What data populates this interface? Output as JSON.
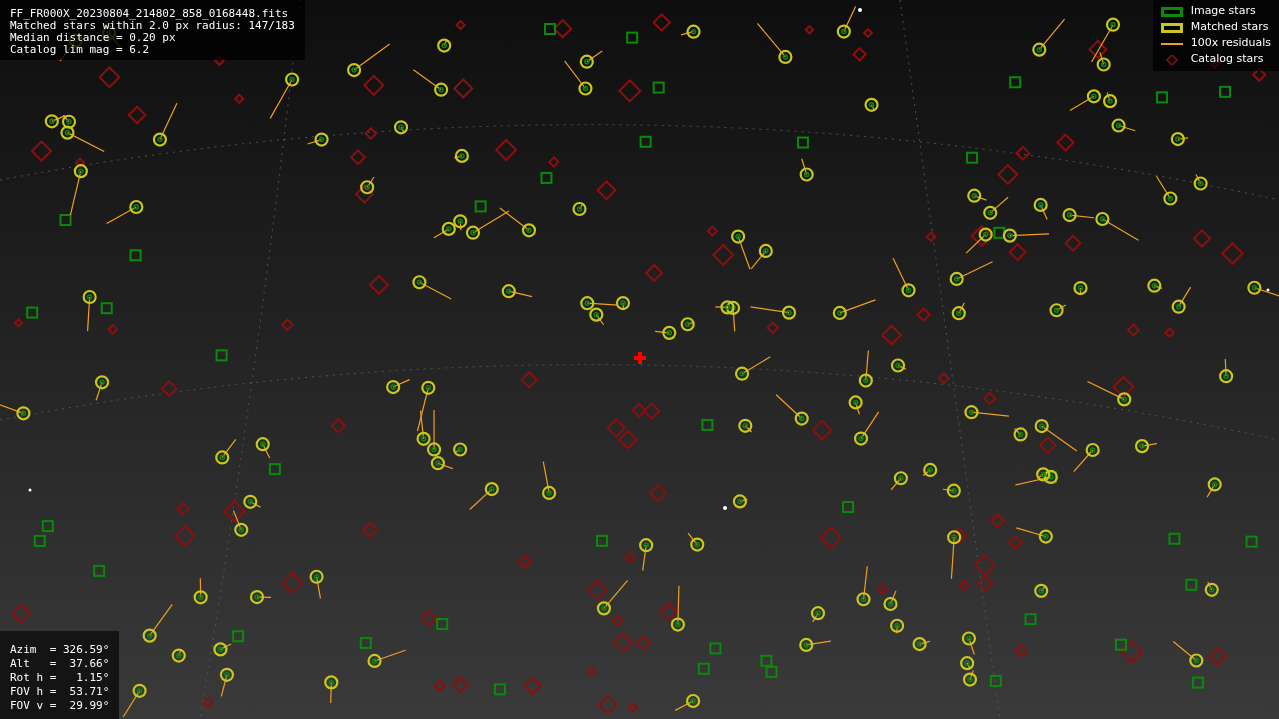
{
  "info_lines": [
    "FF_FR000X_20230804_214802_858_0168448.fits",
    "Matched stars within 2.0 px radius: 147/183",
    "Median distance = 0.20 px",
    "Catalog lim mag = 6.2"
  ],
  "legend": [
    {
      "kind": "box",
      "label": "Image stars",
      "color": "#0a8a0a"
    },
    {
      "kind": "box",
      "label": "Matched stars",
      "color": "#c8c81e"
    },
    {
      "kind": "line",
      "label": "100x residuals",
      "color": "#f0a020"
    },
    {
      "kind": "diamond",
      "label": "Catalog stars",
      "color": "#8a1010"
    }
  ],
  "pointing_lines": [
    "Azim  = 326.59°",
    "Alt   =  37.66°",
    "Rot h =   1.15°",
    "FOV h =  53.71°",
    "FOV v =  29.99°"
  ]
}
